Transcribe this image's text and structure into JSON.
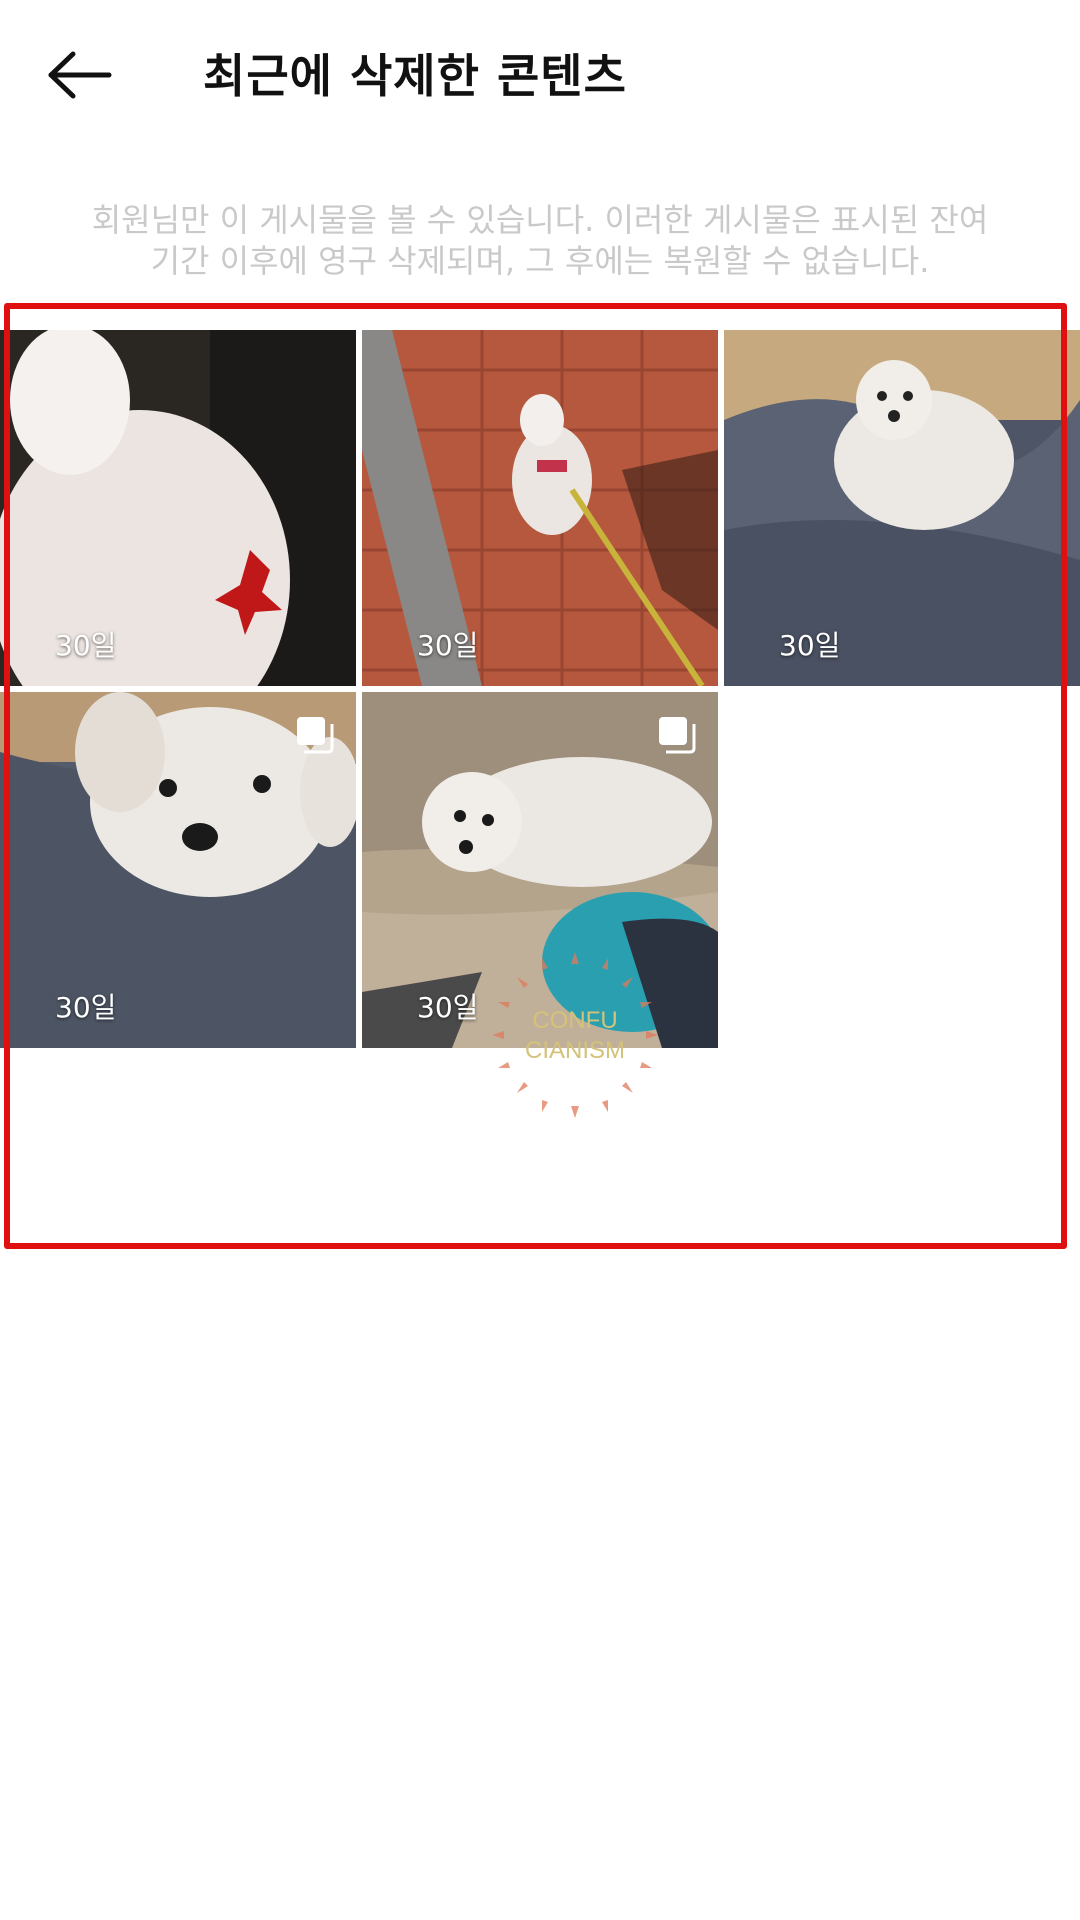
{
  "header": {
    "title": "최근에 삭제한 콘텐츠"
  },
  "description": {
    "line1": "회원님만 이 게시물을 볼 수 있습니다. 이러한 게시물은 표시된 잔여",
    "line2": "기간 이후에 영구 삭제되며, 그 후에는 복원할 수 없습니다."
  },
  "items": [
    {
      "days": "30일",
      "multi": false
    },
    {
      "days": "30일",
      "multi": false
    },
    {
      "days": "30일",
      "multi": false
    },
    {
      "days": "30일",
      "multi": true
    },
    {
      "days": "30일",
      "multi": true
    }
  ],
  "watermark": {
    "line1": "CONFU",
    "line2": "CIANISM"
  },
  "colors": {
    "highlight": "#e01010",
    "description_text": "#c9c9c9"
  }
}
